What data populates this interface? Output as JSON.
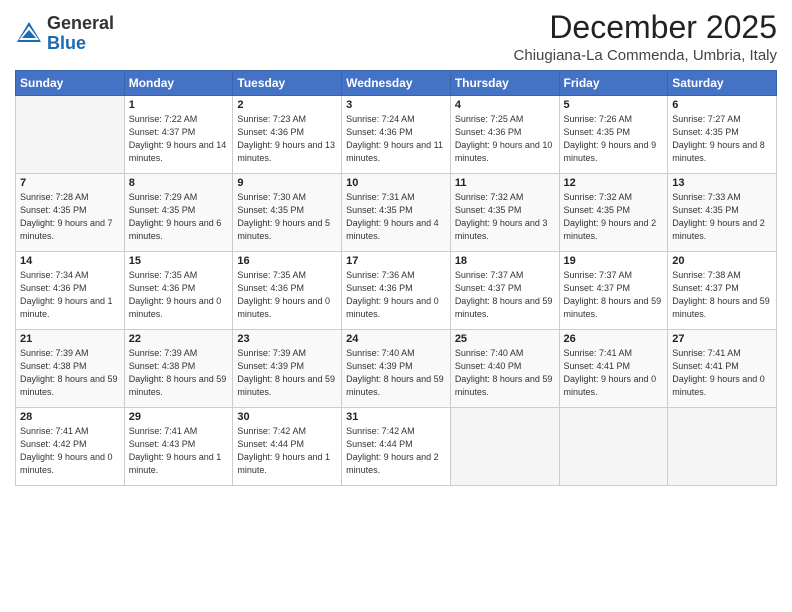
{
  "header": {
    "logo_general": "General",
    "logo_blue": "Blue",
    "month_title": "December 2025",
    "location": "Chiugiana-La Commenda, Umbria, Italy"
  },
  "days_of_week": [
    "Sunday",
    "Monday",
    "Tuesday",
    "Wednesday",
    "Thursday",
    "Friday",
    "Saturday"
  ],
  "weeks": [
    [
      {
        "day": "",
        "empty": true
      },
      {
        "day": "1",
        "sunrise": "7:22 AM",
        "sunset": "4:37 PM",
        "daylight": "9 hours and 14 minutes."
      },
      {
        "day": "2",
        "sunrise": "7:23 AM",
        "sunset": "4:36 PM",
        "daylight": "9 hours and 13 minutes."
      },
      {
        "day": "3",
        "sunrise": "7:24 AM",
        "sunset": "4:36 PM",
        "daylight": "9 hours and 11 minutes."
      },
      {
        "day": "4",
        "sunrise": "7:25 AM",
        "sunset": "4:36 PM",
        "daylight": "9 hours and 10 minutes."
      },
      {
        "day": "5",
        "sunrise": "7:26 AM",
        "sunset": "4:35 PM",
        "daylight": "9 hours and 9 minutes."
      },
      {
        "day": "6",
        "sunrise": "7:27 AM",
        "sunset": "4:35 PM",
        "daylight": "9 hours and 8 minutes."
      }
    ],
    [
      {
        "day": "7",
        "sunrise": "7:28 AM",
        "sunset": "4:35 PM",
        "daylight": "9 hours and 7 minutes."
      },
      {
        "day": "8",
        "sunrise": "7:29 AM",
        "sunset": "4:35 PM",
        "daylight": "9 hours and 6 minutes."
      },
      {
        "day": "9",
        "sunrise": "7:30 AM",
        "sunset": "4:35 PM",
        "daylight": "9 hours and 5 minutes."
      },
      {
        "day": "10",
        "sunrise": "7:31 AM",
        "sunset": "4:35 PM",
        "daylight": "9 hours and 4 minutes."
      },
      {
        "day": "11",
        "sunrise": "7:32 AM",
        "sunset": "4:35 PM",
        "daylight": "9 hours and 3 minutes."
      },
      {
        "day": "12",
        "sunrise": "7:32 AM",
        "sunset": "4:35 PM",
        "daylight": "9 hours and 2 minutes."
      },
      {
        "day": "13",
        "sunrise": "7:33 AM",
        "sunset": "4:35 PM",
        "daylight": "9 hours and 2 minutes."
      }
    ],
    [
      {
        "day": "14",
        "sunrise": "7:34 AM",
        "sunset": "4:36 PM",
        "daylight": "9 hours and 1 minute."
      },
      {
        "day": "15",
        "sunrise": "7:35 AM",
        "sunset": "4:36 PM",
        "daylight": "9 hours and 0 minutes."
      },
      {
        "day": "16",
        "sunrise": "7:35 AM",
        "sunset": "4:36 PM",
        "daylight": "9 hours and 0 minutes."
      },
      {
        "day": "17",
        "sunrise": "7:36 AM",
        "sunset": "4:36 PM",
        "daylight": "9 hours and 0 minutes."
      },
      {
        "day": "18",
        "sunrise": "7:37 AM",
        "sunset": "4:37 PM",
        "daylight": "8 hours and 59 minutes."
      },
      {
        "day": "19",
        "sunrise": "7:37 AM",
        "sunset": "4:37 PM",
        "daylight": "8 hours and 59 minutes."
      },
      {
        "day": "20",
        "sunrise": "7:38 AM",
        "sunset": "4:37 PM",
        "daylight": "8 hours and 59 minutes."
      }
    ],
    [
      {
        "day": "21",
        "sunrise": "7:39 AM",
        "sunset": "4:38 PM",
        "daylight": "8 hours and 59 minutes."
      },
      {
        "day": "22",
        "sunrise": "7:39 AM",
        "sunset": "4:38 PM",
        "daylight": "8 hours and 59 minutes."
      },
      {
        "day": "23",
        "sunrise": "7:39 AM",
        "sunset": "4:39 PM",
        "daylight": "8 hours and 59 minutes."
      },
      {
        "day": "24",
        "sunrise": "7:40 AM",
        "sunset": "4:39 PM",
        "daylight": "8 hours and 59 minutes."
      },
      {
        "day": "25",
        "sunrise": "7:40 AM",
        "sunset": "4:40 PM",
        "daylight": "8 hours and 59 minutes."
      },
      {
        "day": "26",
        "sunrise": "7:41 AM",
        "sunset": "4:41 PM",
        "daylight": "9 hours and 0 minutes."
      },
      {
        "day": "27",
        "sunrise": "7:41 AM",
        "sunset": "4:41 PM",
        "daylight": "9 hours and 0 minutes."
      }
    ],
    [
      {
        "day": "28",
        "sunrise": "7:41 AM",
        "sunset": "4:42 PM",
        "daylight": "9 hours and 0 minutes."
      },
      {
        "day": "29",
        "sunrise": "7:41 AM",
        "sunset": "4:43 PM",
        "daylight": "9 hours and 1 minute."
      },
      {
        "day": "30",
        "sunrise": "7:42 AM",
        "sunset": "4:44 PM",
        "daylight": "9 hours and 1 minute."
      },
      {
        "day": "31",
        "sunrise": "7:42 AM",
        "sunset": "4:44 PM",
        "daylight": "9 hours and 2 minutes."
      },
      {
        "day": "",
        "empty": true
      },
      {
        "day": "",
        "empty": true
      },
      {
        "day": "",
        "empty": true
      }
    ]
  ]
}
